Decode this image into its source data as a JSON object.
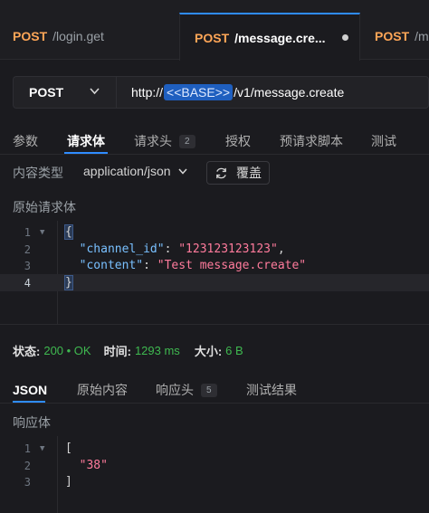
{
  "tabs": [
    {
      "method": "POST",
      "name": "/login.get"
    },
    {
      "method": "POST",
      "name": "/message.cre..."
    },
    {
      "method": "POST",
      "name": "/m"
    }
  ],
  "url_bar": {
    "method": "POST",
    "prefix": "http://",
    "variable": "<<BASE>>",
    "path": "/v1/message.create"
  },
  "request_tabs": [
    {
      "label": "参数"
    },
    {
      "label": "请求体"
    },
    {
      "label": "请求头",
      "badge": "2"
    },
    {
      "label": "授权"
    },
    {
      "label": "预请求脚本"
    },
    {
      "label": "测试"
    }
  ],
  "content_type": {
    "label": "内容类型",
    "value": "application/json",
    "override_label": "覆盖"
  },
  "raw_body_label": "原始请求体",
  "request_body": {
    "line_numbers": [
      "1",
      "2",
      "3",
      "4"
    ],
    "open_brace": "{",
    "close_brace": "}",
    "key1": "\"channel_id\"",
    "val1": "\"123123123123\"",
    "key2": "\"content\"",
    "val2": "\"Test message.create\""
  },
  "status": {
    "status_label": "状态:",
    "status_value": "200 • OK",
    "time_label": "时间:",
    "time_value": "1293 ms",
    "size_label": "大小:",
    "size_value": "6 B"
  },
  "response_tabs": [
    {
      "label": "JSON"
    },
    {
      "label": "原始内容"
    },
    {
      "label": "响应头",
      "badge": "5"
    },
    {
      "label": "测试结果"
    }
  ],
  "response_body_label": "响应体",
  "response_body": {
    "line_numbers": [
      "1",
      "2",
      "3"
    ],
    "open": "[",
    "value": "\"38\"",
    "close": "]"
  },
  "colors": {
    "accent": "#2f8cff",
    "method": "#ffa657",
    "success": "#3fb950",
    "json_key": "#79c0ff",
    "json_string": "#ff7b9c"
  }
}
